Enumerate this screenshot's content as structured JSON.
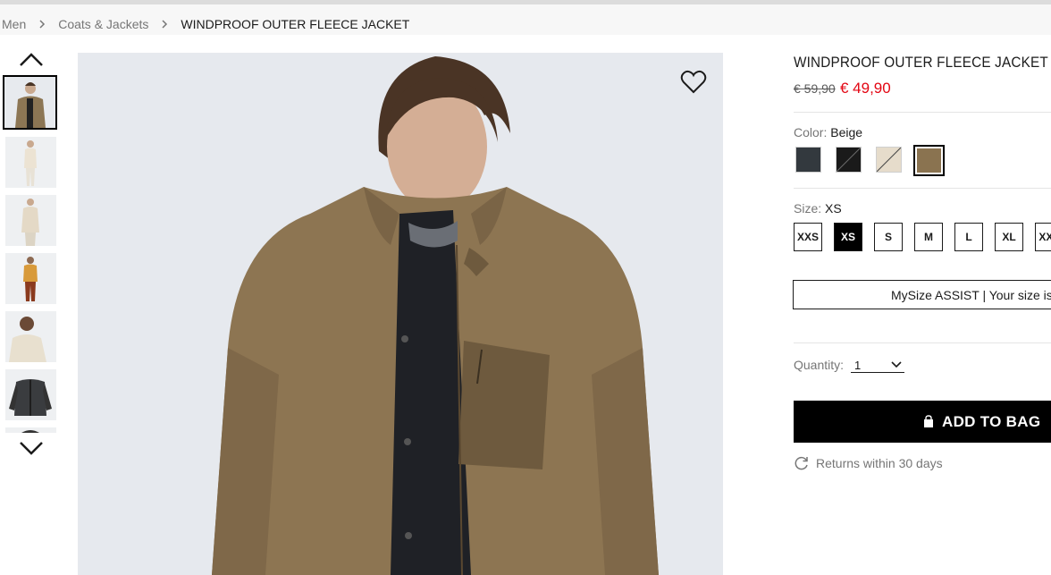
{
  "breadcrumb": {
    "items": [
      "Men",
      "Coats & Jackets"
    ],
    "current": "WINDPROOF OUTER FLEECE JACKET"
  },
  "product": {
    "title": "WINDPROOF OUTER FLEECE JACKET",
    "old_price": "€ 59,90",
    "price": "€ 49,90"
  },
  "color": {
    "label": "Color:",
    "value": "Beige",
    "swatches": [
      {
        "name": "charcoal",
        "hex": "#33393e"
      },
      {
        "name": "black",
        "hex": "#1a1a1a"
      },
      {
        "name": "off-white",
        "hex": "#e6dccb"
      },
      {
        "name": "brown",
        "hex": "#8a7350"
      }
    ]
  },
  "size": {
    "label": "Size:",
    "value": "XS",
    "options": [
      "XXS",
      "XS",
      "S",
      "M",
      "L",
      "XL",
      "XXL"
    ],
    "selected": "XS"
  },
  "mysize_text": "MySize ASSIST | Your size is",
  "quantity": {
    "label": "Quantity:",
    "value": "1"
  },
  "add_to_bag": "ADD TO BAG",
  "returns": "Returns within 30 days",
  "icons": [
    "chevron-right-icon",
    "chevron-up-icon",
    "chevron-down-icon",
    "heart-icon",
    "bag-icon",
    "refresh-icon"
  ],
  "colors": {
    "sale": "#e30613",
    "accent": "#000000"
  }
}
